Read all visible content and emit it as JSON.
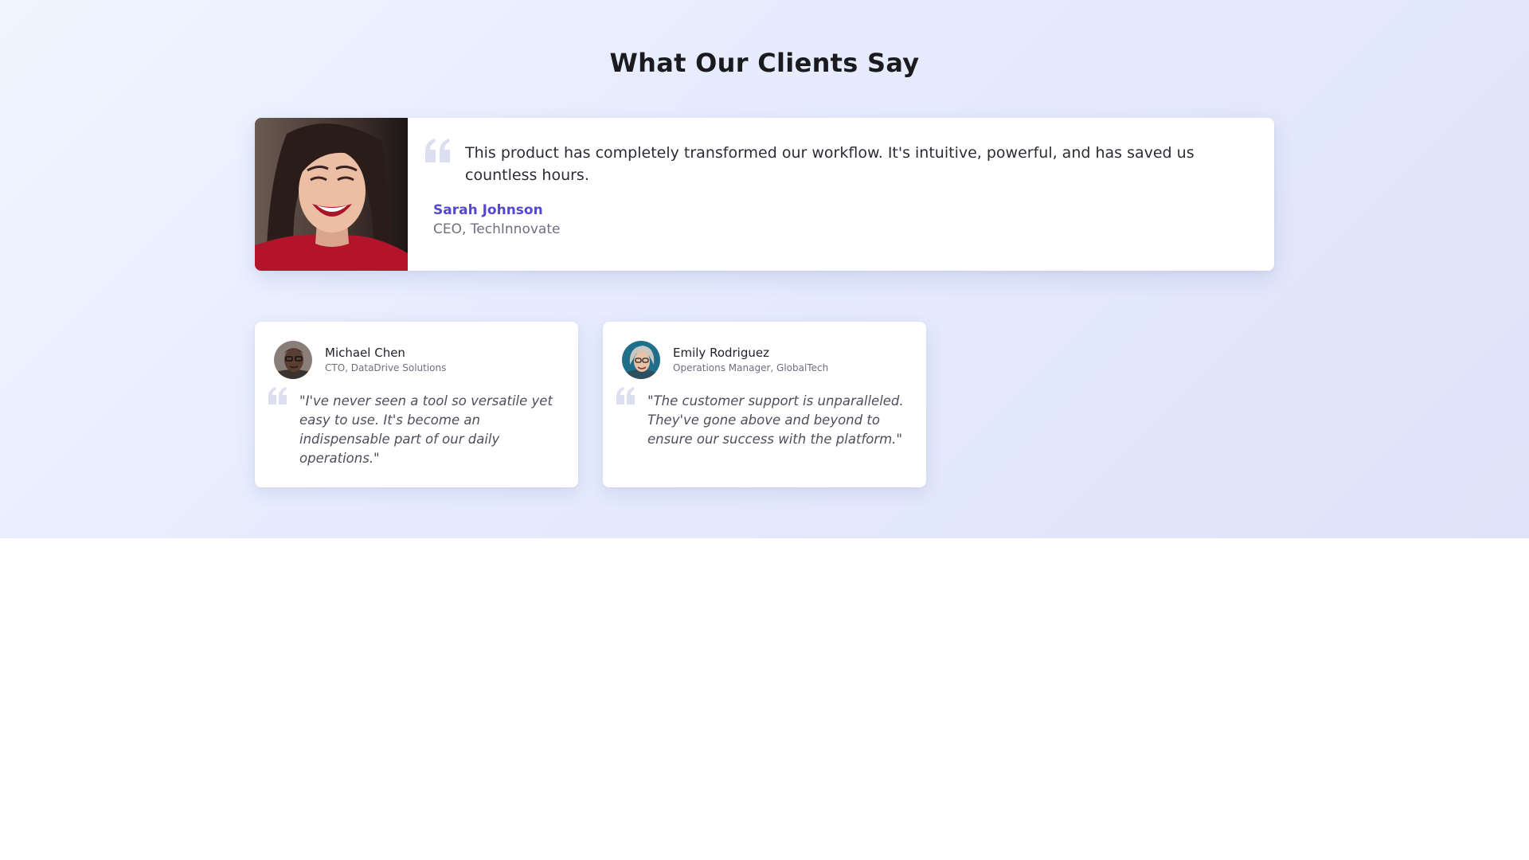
{
  "page": {
    "title": "What Our Clients Say"
  },
  "featured": {
    "text": "This product has completely transformed our workflow. It's intuitive, powerful, and has saved us countless hours.",
    "name": "Sarah Johnson",
    "role": "CEO, TechInnovate",
    "photo_icon": "portrait-photo",
    "quote_icon": "quote-icon"
  },
  "cards": [
    {
      "name": "Michael Chen",
      "role": "CTO, DataDrive Solutions",
      "quote": "\"I've never seen a tool so versatile yet easy to use. It's become an indispensable part of our daily operations.\"",
      "avatar_icon": "avatar-photo"
    },
    {
      "name": "Emily Rodriguez",
      "role": "Operations Manager, GlobalTech",
      "quote": "\"The customer support is unparalleled. They've gone above and beyond to ensure our success with the platform.\"",
      "avatar_icon": "avatar-photo"
    }
  ],
  "colors": {
    "accent": "#5547d6",
    "heading": "#1a1a1f",
    "muted": "#6e7080",
    "quote_mark": "#dcdff0"
  }
}
